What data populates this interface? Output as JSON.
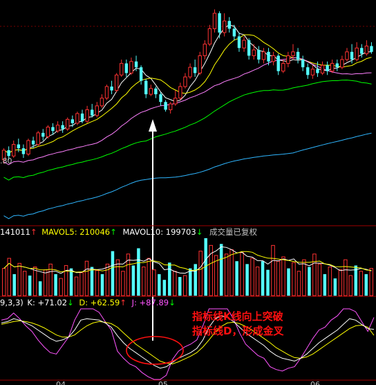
{
  "colors": {
    "background": "#000000",
    "panel_border": "#a00000",
    "up_candle": "#ff3232",
    "down_candle": "#54ffff",
    "ma5": "#ffffff",
    "ma10": "#ffff00",
    "ma20": "#ff80ff",
    "ma30": "#00ff00",
    "ma60": "#2fb6ff",
    "k_line": "#ffffff",
    "d_line": "#ffff00",
    "j_line": "#ff55ff",
    "annotation": "#ff1010",
    "arrow": "#ffffff"
  },
  "price_panel": {
    "price_label": "80"
  },
  "volume_panel": {
    "header_prefix": "141011",
    "mavol5_label": "MAVOL5: 210046",
    "mavol5_arrow": "↑",
    "mavol10_label": "MAVOL10: 199703",
    "mavol10_arrow": "↓",
    "note": "成交量已复权"
  },
  "kdj_panel": {
    "params": "9,3,3)",
    "k_label": "K: +71.02",
    "k_arrow": "↓",
    "d_label": "D: +62.59",
    "d_arrow": "↑",
    "j_label": "J: +87.89",
    "j_arrow": "↓",
    "x_labels": [
      "04",
      "05",
      "06"
    ]
  },
  "annotation": {
    "line1": "指标线K线向上突破",
    "line2": "指标线D，形成金叉"
  },
  "chart_data": [
    {
      "type": "candlestick",
      "description_values_are_relative_price_units": true,
      "candles": [
        {
          "o": 52,
          "c": 57,
          "h": 58,
          "l": 50
        },
        {
          "o": 57,
          "c": 54,
          "h": 59,
          "l": 52
        },
        {
          "o": 54,
          "c": 60,
          "h": 62,
          "l": 53
        },
        {
          "o": 60,
          "c": 58,
          "h": 63,
          "l": 56
        },
        {
          "o": 58,
          "c": 55,
          "h": 60,
          "l": 53
        },
        {
          "o": 55,
          "c": 62,
          "h": 63,
          "l": 54
        },
        {
          "o": 62,
          "c": 60,
          "h": 64,
          "l": 58
        },
        {
          "o": 60,
          "c": 66,
          "h": 67,
          "l": 59
        },
        {
          "o": 66,
          "c": 64,
          "h": 68,
          "l": 62
        },
        {
          "o": 64,
          "c": 69,
          "h": 70,
          "l": 63
        },
        {
          "o": 69,
          "c": 67,
          "h": 71,
          "l": 65
        },
        {
          "o": 67,
          "c": 70,
          "h": 72,
          "l": 66
        },
        {
          "o": 70,
          "c": 68,
          "h": 72,
          "l": 66
        },
        {
          "o": 68,
          "c": 73,
          "h": 74,
          "l": 67
        },
        {
          "o": 73,
          "c": 71,
          "h": 75,
          "l": 69
        },
        {
          "o": 71,
          "c": 76,
          "h": 77,
          "l": 70
        },
        {
          "o": 76,
          "c": 72,
          "h": 78,
          "l": 71
        },
        {
          "o": 72,
          "c": 78,
          "h": 80,
          "l": 71
        },
        {
          "o": 78,
          "c": 75,
          "h": 81,
          "l": 74
        },
        {
          "o": 75,
          "c": 80,
          "h": 82,
          "l": 74
        },
        {
          "o": 80,
          "c": 84,
          "h": 86,
          "l": 79
        },
        {
          "o": 84,
          "c": 90,
          "h": 91,
          "l": 83
        },
        {
          "o": 90,
          "c": 88,
          "h": 93,
          "l": 86
        },
        {
          "o": 88,
          "c": 96,
          "h": 97,
          "l": 87
        },
        {
          "o": 96,
          "c": 102,
          "h": 104,
          "l": 95
        },
        {
          "o": 102,
          "c": 97,
          "h": 104,
          "l": 95
        },
        {
          "o": 97,
          "c": 103,
          "h": 105,
          "l": 96
        },
        {
          "o": 103,
          "c": 100,
          "h": 106,
          "l": 98
        },
        {
          "o": 100,
          "c": 93,
          "h": 101,
          "l": 91
        },
        {
          "o": 93,
          "c": 86,
          "h": 94,
          "l": 84
        },
        {
          "o": 86,
          "c": 89,
          "h": 91,
          "l": 85
        },
        {
          "o": 89,
          "c": 86,
          "h": 90,
          "l": 84
        },
        {
          "o": 86,
          "c": 82,
          "h": 87,
          "l": 80
        },
        {
          "o": 82,
          "c": 78,
          "h": 83,
          "l": 77
        },
        {
          "o": 78,
          "c": 81,
          "h": 82,
          "l": 76
        },
        {
          "o": 81,
          "c": 84,
          "h": 88,
          "l": 80
        },
        {
          "o": 84,
          "c": 90,
          "h": 92,
          "l": 83
        },
        {
          "o": 90,
          "c": 95,
          "h": 97,
          "l": 89
        },
        {
          "o": 95,
          "c": 100,
          "h": 102,
          "l": 94
        },
        {
          "o": 100,
          "c": 97,
          "h": 104,
          "l": 95
        },
        {
          "o": 97,
          "c": 106,
          "h": 108,
          "l": 96
        },
        {
          "o": 106,
          "c": 112,
          "h": 114,
          "l": 104
        },
        {
          "o": 112,
          "c": 120,
          "h": 122,
          "l": 111
        },
        {
          "o": 120,
          "c": 128,
          "h": 130,
          "l": 118
        },
        {
          "o": 128,
          "c": 118,
          "h": 129,
          "l": 115
        },
        {
          "o": 118,
          "c": 124,
          "h": 128,
          "l": 116
        },
        {
          "o": 124,
          "c": 120,
          "h": 126,
          "l": 118
        },
        {
          "o": 120,
          "c": 116,
          "h": 122,
          "l": 114
        },
        {
          "o": 116,
          "c": 110,
          "h": 118,
          "l": 108
        },
        {
          "o": 110,
          "c": 114,
          "h": 116,
          "l": 108
        },
        {
          "o": 114,
          "c": 106,
          "h": 115,
          "l": 104
        },
        {
          "o": 106,
          "c": 109,
          "h": 112,
          "l": 104
        },
        {
          "o": 109,
          "c": 104,
          "h": 111,
          "l": 102
        },
        {
          "o": 104,
          "c": 108,
          "h": 110,
          "l": 102
        },
        {
          "o": 108,
          "c": 103,
          "h": 110,
          "l": 101
        },
        {
          "o": 103,
          "c": 106,
          "h": 108,
          "l": 101
        },
        {
          "o": 106,
          "c": 98,
          "h": 107,
          "l": 96
        },
        {
          "o": 98,
          "c": 102,
          "h": 104,
          "l": 97
        },
        {
          "o": 102,
          "c": 106,
          "h": 108,
          "l": 100
        },
        {
          "o": 106,
          "c": 108,
          "h": 112,
          "l": 104
        },
        {
          "o": 108,
          "c": 104,
          "h": 110,
          "l": 102
        },
        {
          "o": 104,
          "c": 100,
          "h": 106,
          "l": 98
        },
        {
          "o": 100,
          "c": 96,
          "h": 102,
          "l": 94
        },
        {
          "o": 96,
          "c": 99,
          "h": 101,
          "l": 94
        },
        {
          "o": 99,
          "c": 97,
          "h": 103,
          "l": 95
        },
        {
          "o": 97,
          "c": 101,
          "h": 103,
          "l": 96
        },
        {
          "o": 101,
          "c": 98,
          "h": 103,
          "l": 96
        },
        {
          "o": 98,
          "c": 102,
          "h": 104,
          "l": 97
        },
        {
          "o": 102,
          "c": 100,
          "h": 104,
          "l": 98
        },
        {
          "o": 100,
          "c": 104,
          "h": 106,
          "l": 99
        },
        {
          "o": 104,
          "c": 108,
          "h": 110,
          "l": 103
        },
        {
          "o": 108,
          "c": 104,
          "h": 112,
          "l": 102
        },
        {
          "o": 104,
          "c": 110,
          "h": 113,
          "l": 103
        },
        {
          "o": 110,
          "c": 107,
          "h": 112,
          "l": 105
        },
        {
          "o": 107,
          "c": 111,
          "h": 114,
          "l": 106
        },
        {
          "o": 111,
          "c": 108,
          "h": 113,
          "l": 107
        }
      ],
      "moving_averages": [
        "MA5",
        "MA10",
        "MA20",
        "MA30",
        "MA60"
      ]
    },
    {
      "type": "bar",
      "name": "volume",
      "values": [
        38,
        52,
        30,
        45,
        34,
        28,
        40,
        20,
        36,
        44,
        30,
        24,
        42,
        38,
        26,
        32,
        48,
        40,
        35,
        30,
        44,
        62,
        50,
        34,
        58,
        42,
        66,
        40,
        52,
        36,
        30,
        22,
        46,
        34,
        26,
        28,
        38,
        44,
        62,
        80,
        70,
        56,
        72,
        58,
        64,
        48,
        60,
        44,
        52,
        40,
        48,
        36,
        70,
        48,
        54,
        38,
        46,
        34,
        50,
        40,
        58,
        44,
        30,
        40,
        24,
        36,
        50,
        28,
        42,
        34,
        30,
        38
      ],
      "up_flags": [
        1,
        1,
        0,
        1,
        1,
        0,
        1,
        0,
        1,
        1,
        0,
        1,
        1,
        0,
        1,
        1,
        1,
        0,
        1,
        0,
        1,
        0,
        1,
        1,
        1,
        0,
        0,
        1,
        1,
        1,
        0,
        0,
        0,
        1,
        0,
        1,
        0,
        0,
        1,
        0,
        1,
        1,
        0,
        1,
        1,
        0,
        1,
        0,
        1,
        1,
        0,
        0,
        1,
        1,
        1,
        0,
        1,
        1,
        1,
        0,
        1,
        1,
        0,
        1,
        0,
        1,
        1,
        1,
        0,
        1,
        0,
        1
      ],
      "mavol5": 210046,
      "mavol10": 199703
    },
    {
      "type": "line",
      "name": "KDJ",
      "series": [
        {
          "name": "K",
          "values": [
            80,
            82,
            86,
            84,
            80,
            76,
            70,
            64,
            58,
            54,
            56,
            60,
            70,
            84,
            86,
            85,
            84,
            80,
            74,
            62,
            52,
            44,
            38,
            32,
            26,
            20,
            16,
            18,
            24,
            30,
            34,
            38,
            44,
            56,
            74,
            86,
            90,
            88,
            82,
            74,
            66,
            60,
            54,
            48,
            40,
            34,
            30,
            28,
            26,
            30,
            36,
            44,
            52,
            58,
            64,
            70,
            78,
            86,
            84,
            78,
            72,
            71
          ]
        },
        {
          "name": "D",
          "values": [
            78,
            80,
            82,
            83,
            82,
            80,
            77,
            73,
            68,
            63,
            60,
            60,
            63,
            70,
            76,
            80,
            82,
            81,
            79,
            74,
            66,
            58,
            50,
            44,
            38,
            32,
            26,
            23,
            22,
            25,
            29,
            33,
            38,
            46,
            56,
            67,
            75,
            80,
            81,
            79,
            75,
            70,
            64,
            58,
            52,
            45,
            40,
            35,
            31,
            30,
            32,
            36,
            42,
            48,
            54,
            60,
            66,
            72,
            76,
            77,
            74,
            62.59
          ]
        },
        {
          "name": "J",
          "values": [
            84,
            86,
            94,
            86,
            76,
            68,
            56,
            46,
            38,
            36,
            48,
            60,
            84,
            100,
            100,
            100,
            95,
            82,
            70,
            40,
            30,
            22,
            18,
            10,
            4,
            0,
            0,
            6,
            28,
            40,
            46,
            50,
            56,
            76,
            100,
            100,
            100,
            100,
            86,
            66,
            50,
            42,
            34,
            30,
            18,
            14,
            12,
            16,
            18,
            30,
            44,
            58,
            70,
            74,
            84,
            90,
            100,
            100,
            96,
            82,
            68,
            87.89
          ]
        }
      ],
      "labels": {
        "K": 71.02,
        "D": 62.59,
        "J": 87.89
      }
    }
  ]
}
